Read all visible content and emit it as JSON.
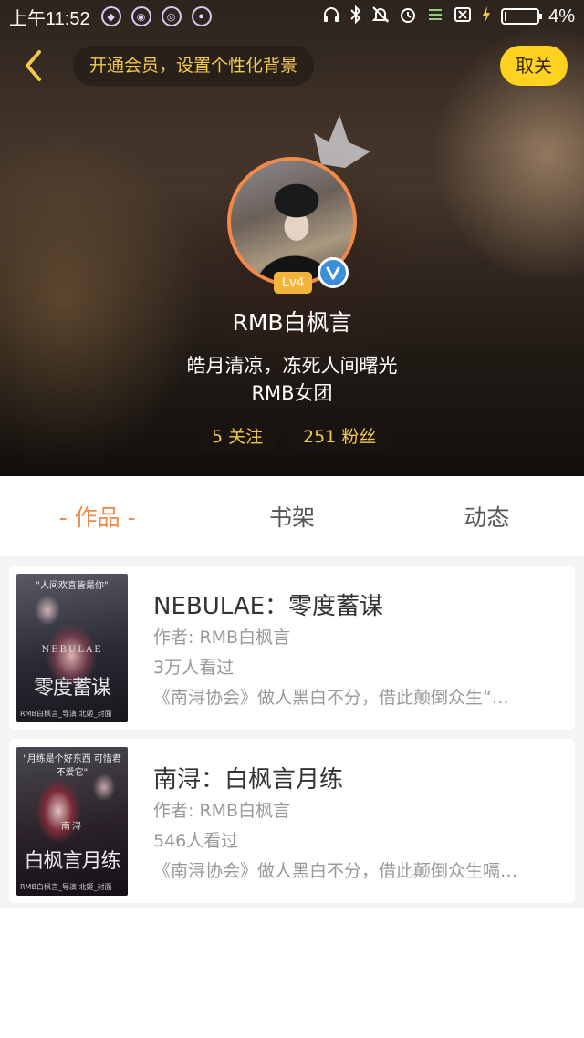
{
  "status_bar": {
    "time": "上午11:52",
    "battery_text": "4%",
    "battery_level": 0.04,
    "left_icons": [
      "shield-app-icon",
      "app-icon-2",
      "app-icon-3",
      "app-icon-4"
    ],
    "right_icons": [
      "headphones-icon",
      "bluetooth-icon",
      "mute-icon",
      "alarm-icon",
      "signal-icon",
      "sim-off-icon",
      "charging-icon",
      "battery-icon"
    ]
  },
  "top_bar": {
    "member_prompt": "开通会员，设置个性化背景",
    "unfollow_label": "取关"
  },
  "profile": {
    "level": "Lv4",
    "username": "RMB白枫言",
    "bio_line1": "皓月清凉，冻死人间曙光",
    "bio_line2": "RMB女团",
    "following": "5 关注",
    "followers": "251 粉丝"
  },
  "tabs": [
    {
      "label": "- 作品 -",
      "active": true
    },
    {
      "label": "书架",
      "active": false
    },
    {
      "label": "动态",
      "active": false
    }
  ],
  "books": [
    {
      "title": "NEBULAE：零度蓄谋",
      "author": "作者: RMB白枫言",
      "views": "3万人看过",
      "description": "《南浔协会》做人黑白不分，借此颠倒众生“…",
      "cover": {
        "top_text": "\"人间欢喜皆是你\"",
        "subtitle": "NEBULAE",
        "title": "零度蓄谋",
        "credit": "RMB白枫言_导演 北姬_封面"
      }
    },
    {
      "title": "南浔：白枫言月练",
      "author": "作者: RMB白枫言",
      "views": "546人看过",
      "description": "《南浔协会》做人黑白不分，借此颠倒众生嗝…",
      "cover": {
        "top_text": "\"月练是个好东西 可惜君不爱它\"",
        "subtitle": "南浔",
        "title": "白枫言月练",
        "credit": "RMB白枫言_导演 北姬_封面"
      }
    }
  ],
  "colors": {
    "accent_orange": "#f08a4b",
    "gold": "#f2c94c",
    "unfollow_bg": "#ffd21f",
    "verified_blue": "#3b8fd8"
  }
}
